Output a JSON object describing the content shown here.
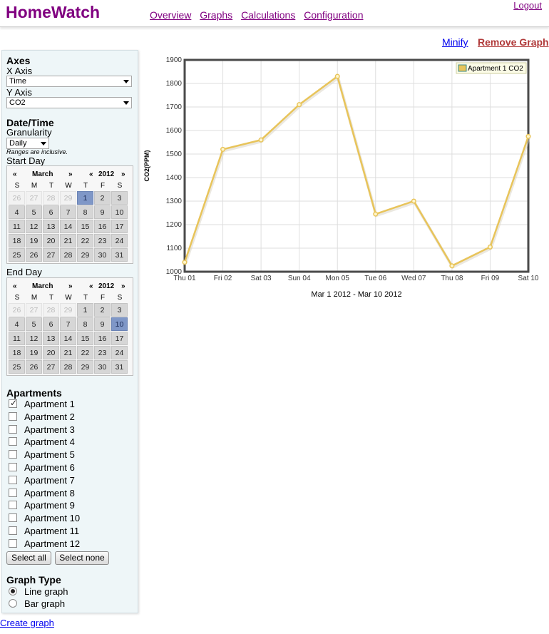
{
  "header": {
    "brand": "HomeWatch",
    "nav": [
      "Overview",
      "Graphs",
      "Calculations",
      "Configuration"
    ],
    "logout": "Logout"
  },
  "graph_actions": {
    "minify": "Minify",
    "remove": "Remove Graph"
  },
  "axes": {
    "title": "Axes",
    "x_label": "X Axis",
    "x_value": "Time",
    "y_label": "Y Axis",
    "y_value": "CO2"
  },
  "datetime": {
    "title": "Date/Time",
    "granularity_label": "Granularity",
    "granularity_value": "Daily",
    "note": "Ranges are inclusive.",
    "start_label": "Start Day",
    "end_label": "End Day",
    "dow": [
      "S",
      "M",
      "T",
      "W",
      "T",
      "F",
      "S"
    ],
    "start_calendar": {
      "prev_month": "«",
      "month": "March",
      "next_month": "»",
      "prev_year": "«",
      "year": "2012",
      "next_year": "»",
      "selected": "1"
    },
    "end_calendar": {
      "prev_month": "«",
      "month": "March",
      "next_month": "»",
      "prev_year": "«",
      "year": "2012",
      "next_year": "»",
      "selected": "10"
    },
    "weeks": [
      [
        "26",
        "27",
        "28",
        "29",
        "1",
        "2",
        "3"
      ],
      [
        "4",
        "5",
        "6",
        "7",
        "8",
        "9",
        "10"
      ],
      [
        "11",
        "12",
        "13",
        "14",
        "15",
        "16",
        "17"
      ],
      [
        "18",
        "19",
        "20",
        "21",
        "22",
        "23",
        "24"
      ],
      [
        "25",
        "26",
        "27",
        "28",
        "29",
        "30",
        "31"
      ]
    ]
  },
  "apartments": {
    "title": "Apartments",
    "items": [
      {
        "label": "Apartment 1",
        "checked": true
      },
      {
        "label": "Apartment 2",
        "checked": false
      },
      {
        "label": "Apartment 3",
        "checked": false
      },
      {
        "label": "Apartment 4",
        "checked": false
      },
      {
        "label": "Apartment 5",
        "checked": false
      },
      {
        "label": "Apartment 6",
        "checked": false
      },
      {
        "label": "Apartment 7",
        "checked": false
      },
      {
        "label": "Apartment 8",
        "checked": false
      },
      {
        "label": "Apartment 9",
        "checked": false
      },
      {
        "label": "Apartment 10",
        "checked": false
      },
      {
        "label": "Apartment 11",
        "checked": false
      },
      {
        "label": "Apartment 12",
        "checked": false
      }
    ],
    "select_all": "Select all",
    "select_none": "Select none"
  },
  "graph_type": {
    "title": "Graph Type",
    "options": [
      {
        "label": "Line graph",
        "selected": true
      },
      {
        "label": "Bar graph",
        "selected": false
      }
    ]
  },
  "create_graph": "Create graph",
  "colors": {
    "brand": "#800080",
    "series": "#e8c45a",
    "selected_day": "#7f97c7"
  },
  "chart_data": {
    "type": "line",
    "categories": [
      "Thu 01",
      "Fri 02",
      "Sat 03",
      "Sun 04",
      "Mon 05",
      "Tue 06",
      "Wed 07",
      "Thu 08",
      "Fri 09",
      "Sat 10"
    ],
    "series": [
      {
        "name": "Apartment 1 CO2",
        "values": [
          1040,
          1520,
          1560,
          1710,
          1830,
          1245,
          1300,
          1025,
          1105,
          1575
        ]
      }
    ],
    "ylabel": "CO2(PPM)",
    "xlabel": "Mar 1 2012 - Mar 10 2012",
    "ylim": [
      1000,
      1900
    ],
    "yticks": [
      1000,
      1100,
      1200,
      1300,
      1400,
      1500,
      1600,
      1700,
      1800,
      1900
    ],
    "grid": true,
    "legend": "top-right"
  }
}
